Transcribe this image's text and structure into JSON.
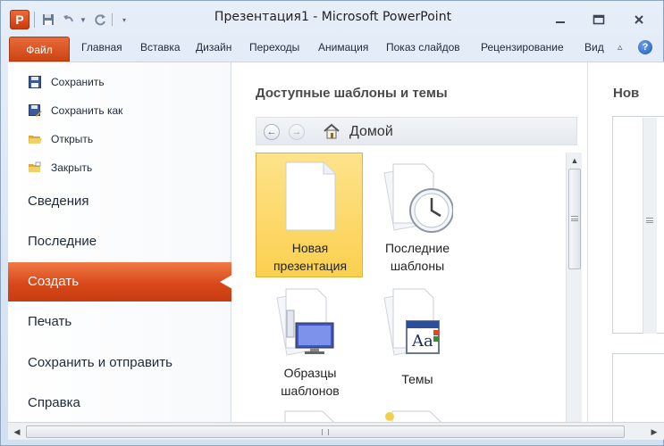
{
  "window": {
    "title": "Презентация1 - Microsoft PowerPoint",
    "app_icon_letter": "P"
  },
  "ribbon": {
    "file_tab": "Файл",
    "tabs": [
      "Главная",
      "Вставка",
      "Дизайн",
      "Переходы",
      "Анимация",
      "Показ слайдов",
      "Рецензирование",
      "Вид"
    ],
    "help": "?"
  },
  "backstage": {
    "commands": [
      {
        "label": "Сохранить",
        "icon": "save-icon"
      },
      {
        "label": "Сохранить как",
        "icon": "save-as-icon"
      },
      {
        "label": "Открыть",
        "icon": "open-folder-icon"
      },
      {
        "label": "Закрыть",
        "icon": "close-folder-icon"
      }
    ],
    "nav": [
      "Сведения",
      "Последние",
      "Создать",
      "Печать",
      "Сохранить и отправить",
      "Справка"
    ],
    "active_nav": "Создать"
  },
  "templates": {
    "heading": "Доступные шаблоны и темы",
    "breadcrumb": "Домой",
    "tiles": [
      {
        "line1": "Новая",
        "line2": "презентация",
        "icon": "blank-document-icon",
        "selected": true
      },
      {
        "line1": "Последние",
        "line2": "шаблоны",
        "icon": "recent-templates-clock-icon",
        "selected": false
      },
      {
        "line1": "Образцы",
        "line2": "шаблонов",
        "icon": "sample-templates-icon",
        "selected": false
      },
      {
        "line1": "Темы",
        "line2": "",
        "icon": "themes-icon",
        "selected": false
      }
    ]
  },
  "preview": {
    "heading": "Нов"
  },
  "colors": {
    "accent_orange": "#d9481a",
    "selected_tile": "#fbd04f"
  }
}
